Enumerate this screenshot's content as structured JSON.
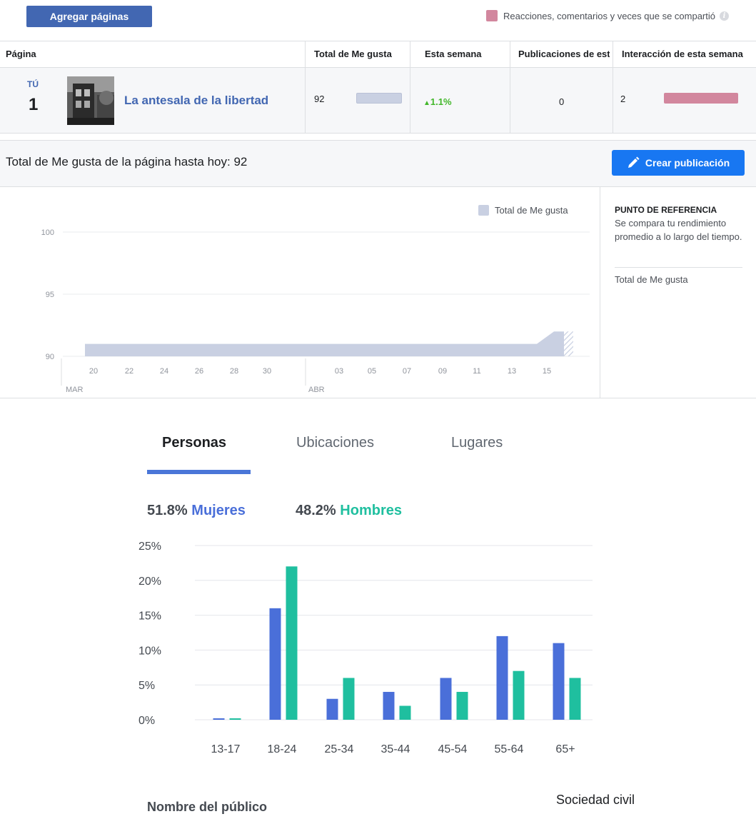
{
  "toolbar": {
    "add_pages_label": "Agregar páginas",
    "legend_label": "Reacciones, comentarios y veces que se compartió",
    "legend_color": "#d2879e",
    "info_icon": "info-icon"
  },
  "table": {
    "headers": [
      "Página",
      "Total de Me gusta",
      "Esta semana",
      "Publicaciones de esta semana",
      "Interacción de esta semana"
    ],
    "row": {
      "you_label": "TÚ",
      "rank": "1",
      "page_name": "La antesala de la libertad",
      "total_likes": "92",
      "this_week_change": "1.1%",
      "posts_this_week": "0",
      "engagement_this_week": "2"
    }
  },
  "likes_section": {
    "title": "Total de Me gusta de la página hasta hoy: 92",
    "create_post_label": "Crear publicación",
    "benchmark_title": "PUNTO DE REFERENCIA",
    "benchmark_desc": "Se compara tu rendimiento promedio a lo largo del tiempo.",
    "benchmark_item": "Total de Me gusta"
  },
  "audience": {
    "tabs": [
      "Personas",
      "Ubicaciones",
      "Lugares"
    ],
    "women_pct": "51.8%",
    "women_label": "Mujeres",
    "men_pct": "48.2%",
    "men_label": "Hombres",
    "audience_name_label": "Nombre del público",
    "audience_name_value": "Sociedad civil"
  },
  "chart_data": [
    {
      "type": "area",
      "legend": [
        "Total de Me gusta"
      ],
      "x_ticks": [
        "20",
        "22",
        "24",
        "26",
        "28",
        "30",
        "03",
        "05",
        "07",
        "09",
        "11",
        "13",
        "15"
      ],
      "month_labels": [
        "MAR",
        "ABR"
      ],
      "y_ticks": [
        "90",
        "95",
        "100"
      ],
      "ylim": [
        90,
        100
      ],
      "series": [
        {
          "name": "Total de Me gusta",
          "x": [
            "MAR 20",
            "ABR 14",
            "ABR 15",
            "ABR 16"
          ],
          "values": [
            91,
            91,
            92,
            92
          ],
          "color": "#c9d0e2"
        }
      ]
    },
    {
      "type": "bar",
      "categories": [
        "13-17",
        "18-24",
        "25-34",
        "35-44",
        "45-54",
        "55-64",
        "65+"
      ],
      "y_ticks": [
        "0%",
        "5%",
        "10%",
        "15%",
        "20%",
        "25%"
      ],
      "ylim": [
        0,
        25
      ],
      "series": [
        {
          "name": "Mujeres",
          "values": [
            0.1,
            16,
            3,
            4,
            6,
            12,
            11
          ],
          "color": "#4a6fd9"
        },
        {
          "name": "Hombres",
          "values": [
            0.1,
            22,
            6,
            2,
            4,
            7,
            6
          ],
          "color": "#1fbf9f"
        }
      ]
    }
  ]
}
